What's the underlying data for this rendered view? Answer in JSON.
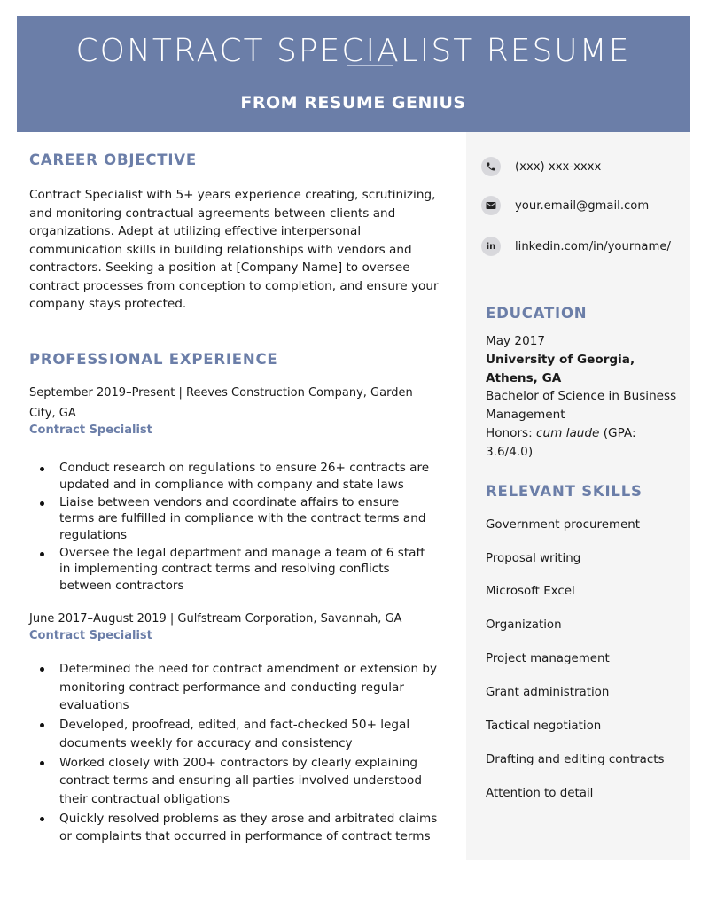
{
  "header": {
    "title": "CONTRACT SPECIALIST RESUME",
    "subtitle": "FROM RESUME GENIUS"
  },
  "colors": {
    "accent": "#6b7ea8",
    "sidebar_bg": "#f5f5f5",
    "text": "#1a1a1a",
    "icon_bg": "#d8d8dc"
  },
  "career_objective": {
    "heading": "CAREER OBJECTIVE",
    "lines": [
      "Contract Specialist with 5+ years experience creating, scrutinizing,",
      "and monitoring contractual agreements between clients and",
      "organizations. Adept at utilizing effective interpersonal",
      "communication skills in building relationships with vendors and",
      "contractors. Seeking a position at [Company Name] to oversee",
      "contract processes from conception to completion, and ensure your",
      "company stays protected."
    ]
  },
  "experience": {
    "heading": "PROFESSIONAL EXPERIENCE",
    "jobs": [
      {
        "header_lines": [
          "September 2019–Present | Reeves Construction Company, Garden",
          "City, GA"
        ],
        "title": "Contract Specialist",
        "bullets": [
          [
            "Conduct research on regulations to ensure 26+ contracts are",
            "updated and in compliance with company and state laws"
          ],
          [
            "Liaise between vendors and coordinate affairs to ensure",
            "terms are fulfilled in compliance with the contract terms and",
            "regulations"
          ],
          [
            "Oversee the legal department and manage a team of 6 staff",
            "in implementing contract terms and resolving conflicts",
            "between contractors"
          ]
        ]
      },
      {
        "header_lines": [
          "June 2017–August 2019 | Gulfstream Corporation, Savannah, GA"
        ],
        "title": "Contract Specialist",
        "bullets": [
          [
            "Determined the need for contract amendment or extension by",
            "monitoring contract performance and conducting regular",
            "evaluations"
          ],
          [
            "Developed, proofread, edited, and fact-checked 50+ legal",
            "documents weekly for accuracy and consistency"
          ],
          [
            "Worked closely with 200+ contractors by clearly explaining",
            "contract terms and ensuring all parties involved understood",
            "their contractual obligations"
          ],
          [
            "Quickly resolved problems as they arose and arbitrated claims",
            "or complaints that occurred in performance of contract terms"
          ]
        ]
      }
    ]
  },
  "contact": {
    "phone": {
      "icon": "phone-icon",
      "text": "(xxx) xxx-xxxx"
    },
    "email": {
      "icon": "email-icon",
      "text": "your.email@gmail.com"
    },
    "linkedin": {
      "icon": "linkedin-icon",
      "text": "linkedin.com/in/yourname/"
    }
  },
  "education": {
    "heading": "EDUCATION",
    "date": "May 2017",
    "school_line1": "University of Georgia,",
    "school_line2": "Athens, GA",
    "degree_line1": "Bachelor of Science in Business",
    "degree_line2": "Management",
    "honors_prefix": "Honors: ",
    "honors_italic": "cum laude",
    "honors_suffix": " (GPA: 3.6/4.0)"
  },
  "skills": {
    "heading": "RELEVANT SKILLS",
    "items": [
      "Government procurement",
      "Proposal writing",
      "Microsoft Excel",
      "Organization",
      "Project management",
      "Grant administration",
      "Tactical negotiation",
      "Drafting and editing contracts",
      "Attention to detail"
    ]
  }
}
